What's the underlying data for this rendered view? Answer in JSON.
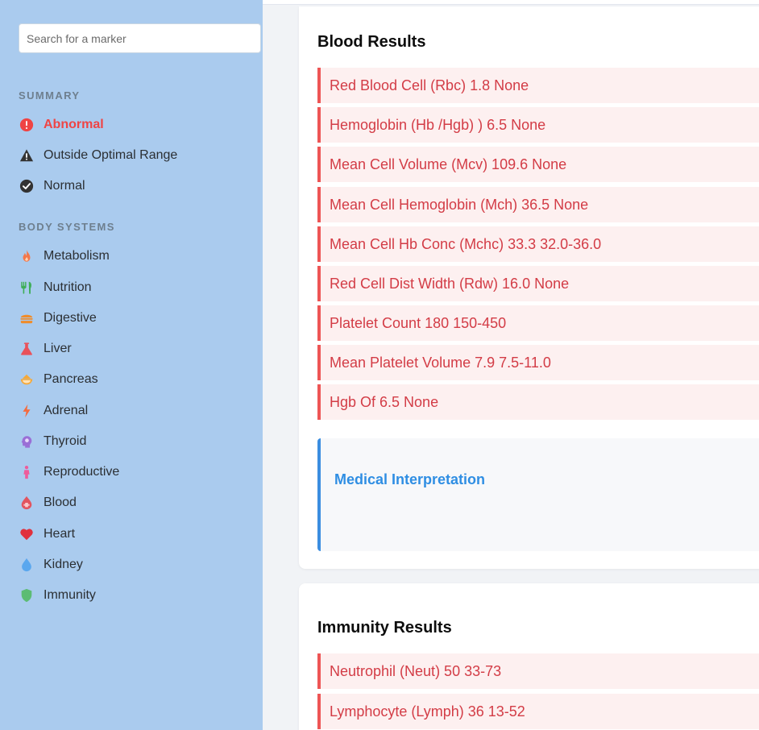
{
  "search": {
    "placeholder": "Search for a marker"
  },
  "sidebar": {
    "summary_title": "SUMMARY",
    "summary_items": [
      {
        "label": "Abnormal",
        "icon": "alert-circle-icon",
        "color": "#ef4444",
        "active": true
      },
      {
        "label": "Outside Optimal Range",
        "icon": "warning-triangle-icon",
        "color": "#333333"
      },
      {
        "label": "Normal",
        "icon": "check-circle-icon",
        "color": "#333333"
      }
    ],
    "systems_title": "BODY SYSTEMS",
    "system_items": [
      {
        "label": "Metabolism",
        "icon": "flame-icon",
        "color": "#f4774a"
      },
      {
        "label": "Nutrition",
        "icon": "utensils-icon",
        "color": "#3fae58"
      },
      {
        "label": "Digestive",
        "icon": "burger-icon",
        "color": "#f08c2a"
      },
      {
        "label": "Liver",
        "icon": "flask-icon",
        "color": "#e9525b"
      },
      {
        "label": "Pancreas",
        "icon": "bowl-icon",
        "color": "#f5a93a"
      },
      {
        "label": "Adrenal",
        "icon": "bolt-icon",
        "color": "#f56b3d"
      },
      {
        "label": "Thyroid",
        "icon": "head-icon",
        "color": "#9a6fd6"
      },
      {
        "label": "Reproductive",
        "icon": "person-icon",
        "color": "#ee5c9b"
      },
      {
        "label": "Blood",
        "icon": "blood-drop-icon",
        "color": "#e2545f"
      },
      {
        "label": "Heart",
        "icon": "heart-icon",
        "color": "#e0303d"
      },
      {
        "label": "Kidney",
        "icon": "water-drop-icon",
        "color": "#5aa7ee"
      },
      {
        "label": "Immunity",
        "icon": "shield-icon",
        "color": "#5cbc74"
      }
    ]
  },
  "blood": {
    "title": "Blood Results",
    "results": [
      "Red Blood Cell (Rbc) 1.8 None",
      "Hemoglobin (Hb /Hgb) ) 6.5 None",
      "Mean Cell Volume (Mcv) 109.6 None",
      "Mean Cell Hemoglobin (Mch) 36.5 None",
      "Mean Cell Hb Conc (Mchc) 33.3 32.0-36.0",
      "Red Cell Dist Width (Rdw) 16.0 None",
      "Platelet Count 180 150-450",
      "Mean Platelet Volume 7.9 7.5-11.0",
      "Hgb Of 6.5 None"
    ],
    "interpretation_title": "Medical Interpretation"
  },
  "immunity": {
    "title": "Immunity Results",
    "results": [
      "Neutrophil (Neut) 50 33-73",
      "Lymphocyte (Lymph) 36 13-52"
    ]
  },
  "colors": {
    "sidebar_bg": "#aacbee",
    "abnormal": "#ef4444",
    "result_text": "#d33c46",
    "accent_blue": "#2f8ee3"
  }
}
